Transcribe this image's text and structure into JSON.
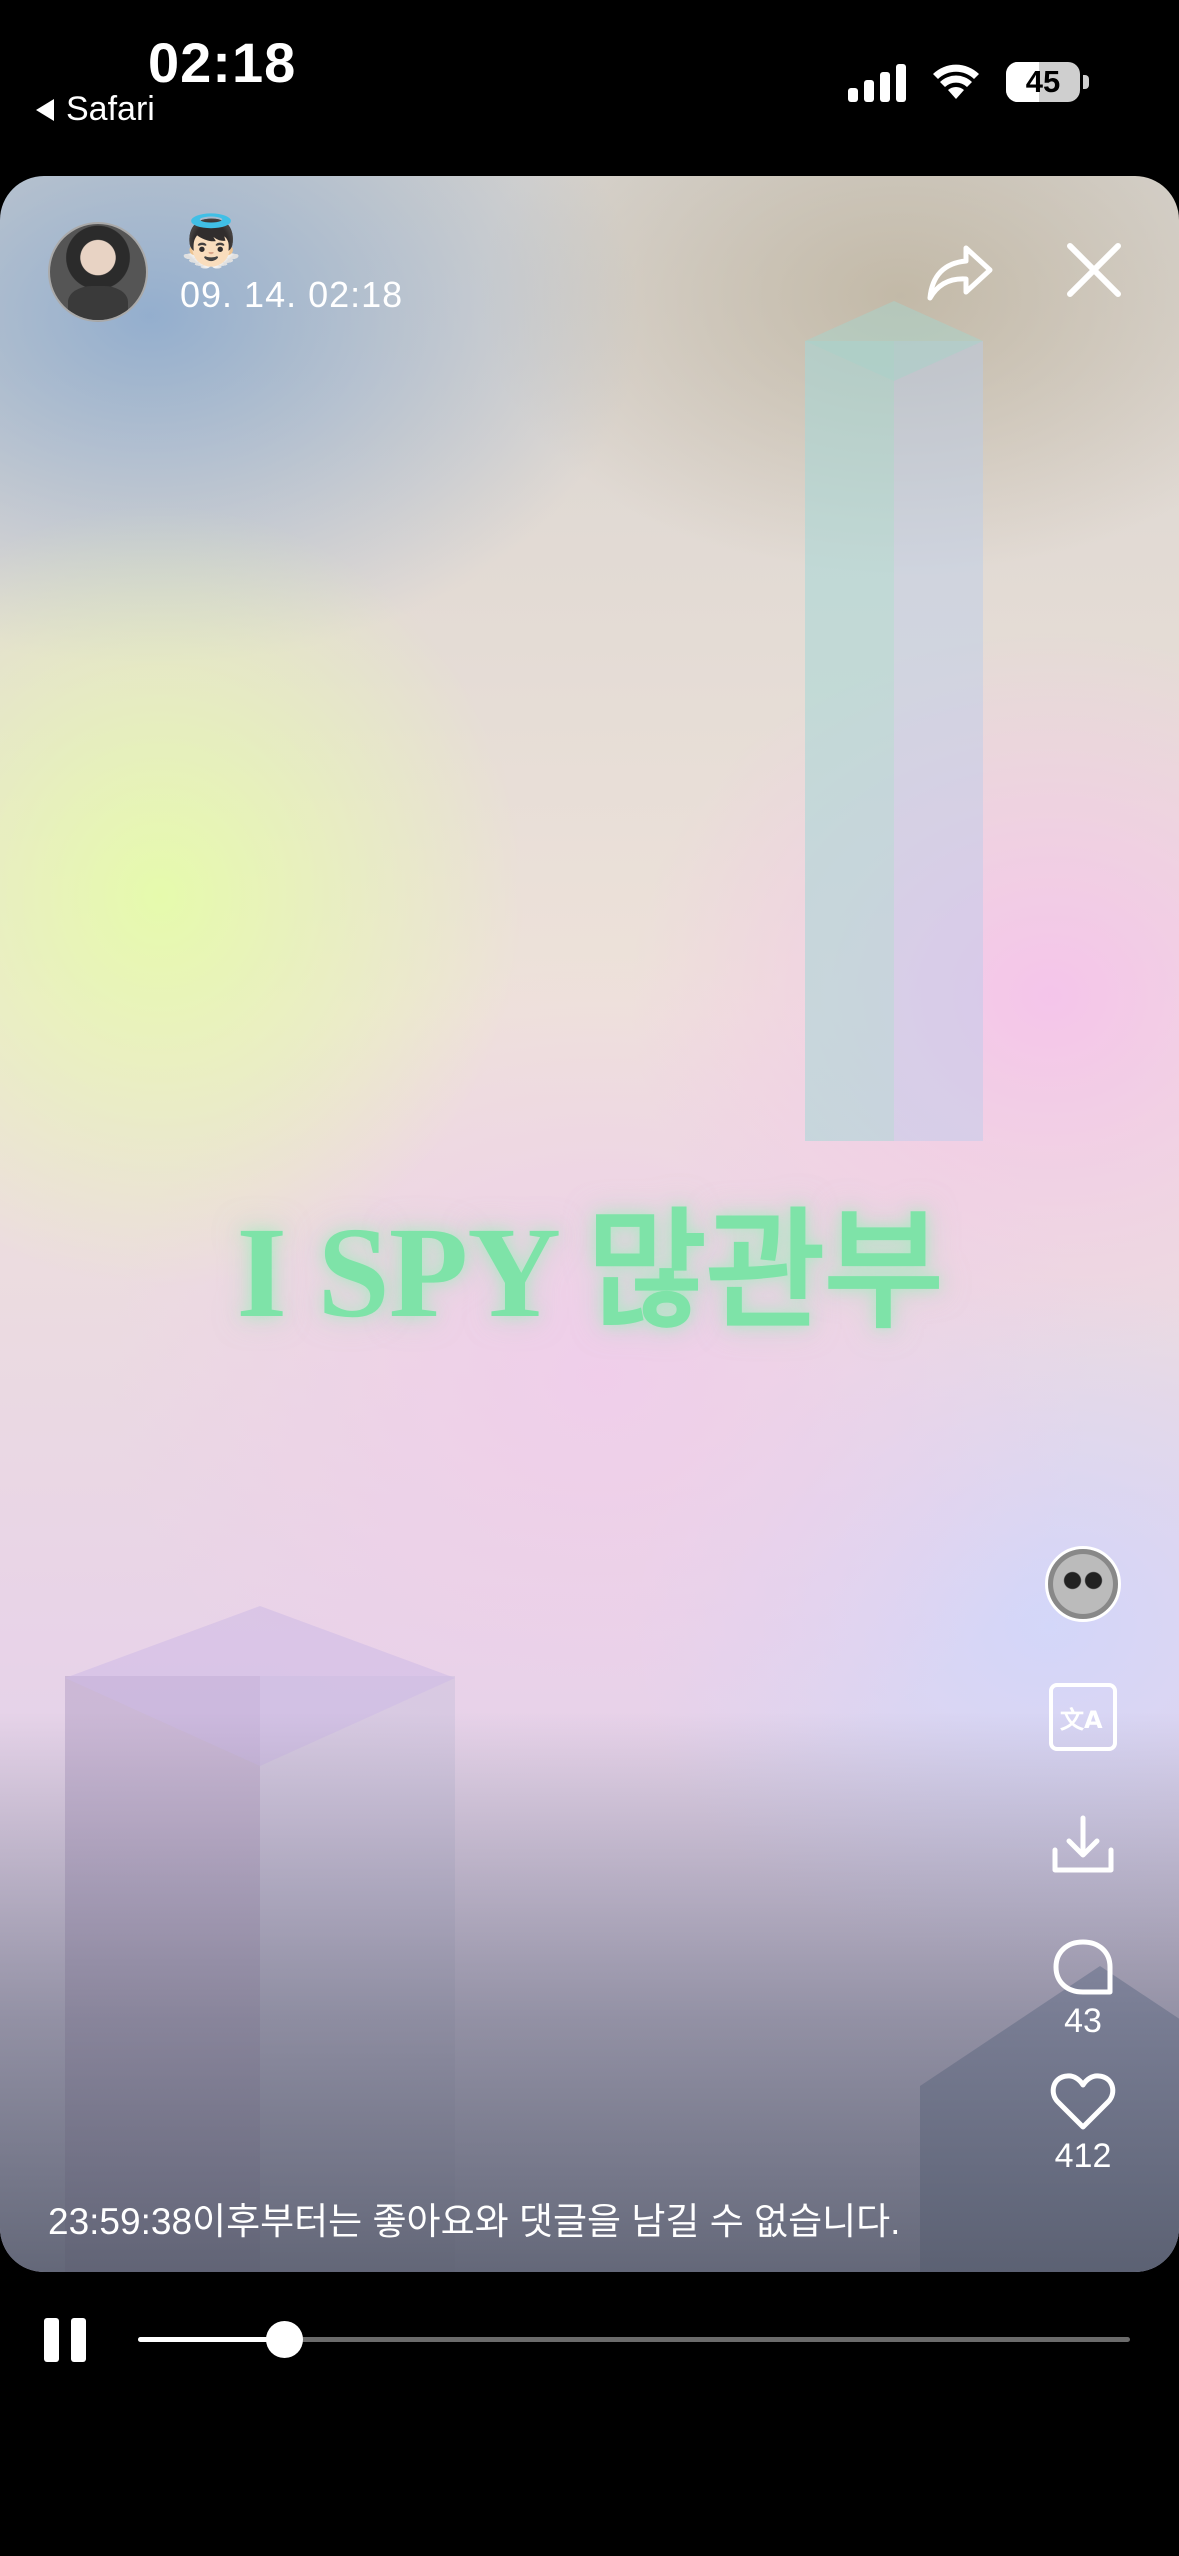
{
  "status_bar": {
    "time": "02:18",
    "back_app": "Safari",
    "battery_level": "45",
    "battery_fraction": 0.45,
    "icons": [
      "cellular-signal-icon",
      "wifi-icon",
      "battery-icon"
    ]
  },
  "story": {
    "mood_emoji": "👼🏻",
    "post_time": "09. 14. 02:18",
    "main_text": "I SPY 많관부",
    "notice": "23:59:38이후부터는 좋아요와 댓글을 남길 수 없습니다.",
    "comment_count": "43",
    "like_count": "412",
    "actions": [
      "music-disc",
      "translate-icon",
      "download-icon",
      "comment-icon",
      "heart-icon"
    ],
    "top_actions": [
      "share-icon",
      "close-icon"
    ]
  },
  "player": {
    "state": "playing",
    "progress": 0.147
  },
  "colors": {
    "background": "#000000",
    "main_text": "#7ee3a8",
    "track": "#6b6b6b",
    "played": "#ffffff"
  }
}
